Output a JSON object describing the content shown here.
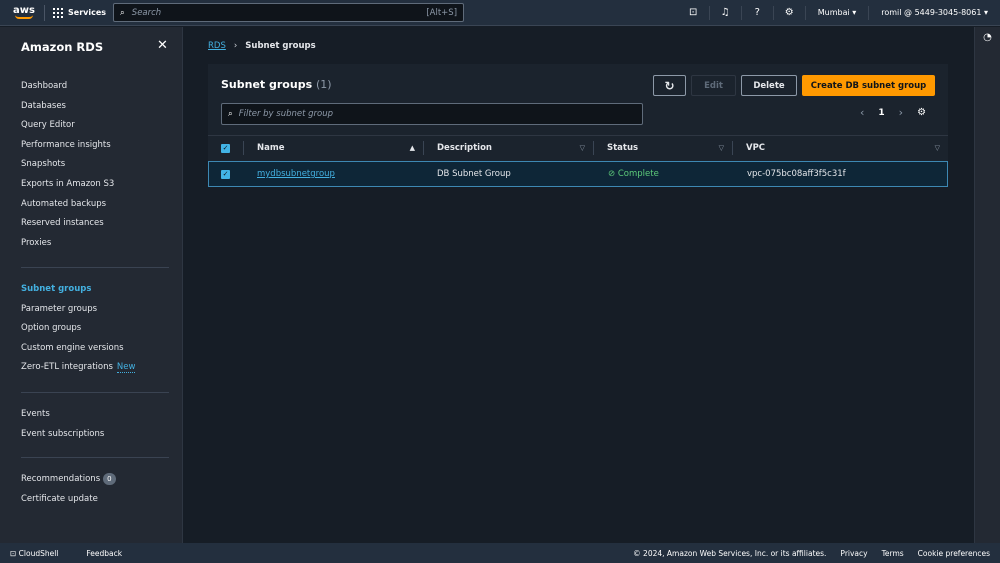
{
  "topbar": {
    "logo": "aws",
    "services": "Services",
    "search_placeholder": "Search",
    "search_shortcut": "[Alt+S]",
    "region": "Mumbai",
    "account": "romil @ 5449-3045-8061"
  },
  "sidebar": {
    "title": "Amazon RDS",
    "group1": [
      "Dashboard",
      "Databases",
      "Query Editor",
      "Performance insights",
      "Snapshots",
      "Exports in Amazon S3",
      "Automated backups",
      "Reserved instances",
      "Proxies"
    ],
    "group2": [
      "Subnet groups",
      "Parameter groups",
      "Option groups",
      "Custom engine versions",
      "Zero-ETL integrations"
    ],
    "new_badge": "New",
    "group3": [
      "Events",
      "Event subscriptions"
    ],
    "group4": [
      "Recommendations",
      "Certificate update"
    ],
    "recommendations_count": "0"
  },
  "breadcrumb": {
    "root": "RDS",
    "current": "Subnet groups"
  },
  "panel": {
    "title": "Subnet groups",
    "count": "(1)",
    "edit": "Edit",
    "delete": "Delete",
    "create": "Create DB subnet group",
    "filter_placeholder": "Filter by subnet group",
    "page": "1"
  },
  "table": {
    "headers": [
      "Name",
      "Description",
      "Status",
      "VPC"
    ],
    "rows": [
      {
        "name": "mydbsubnetgroup",
        "description": "DB Subnet Group",
        "status": "Complete",
        "vpc": "vpc-075bc08aff3f5c31f"
      }
    ]
  },
  "footer": {
    "cloudshell": "CloudShell",
    "feedback": "Feedback",
    "copyright": "© 2024, Amazon Web Services, Inc. or its affiliates.",
    "privacy": "Privacy",
    "terms": "Terms",
    "cookies": "Cookie preferences"
  }
}
